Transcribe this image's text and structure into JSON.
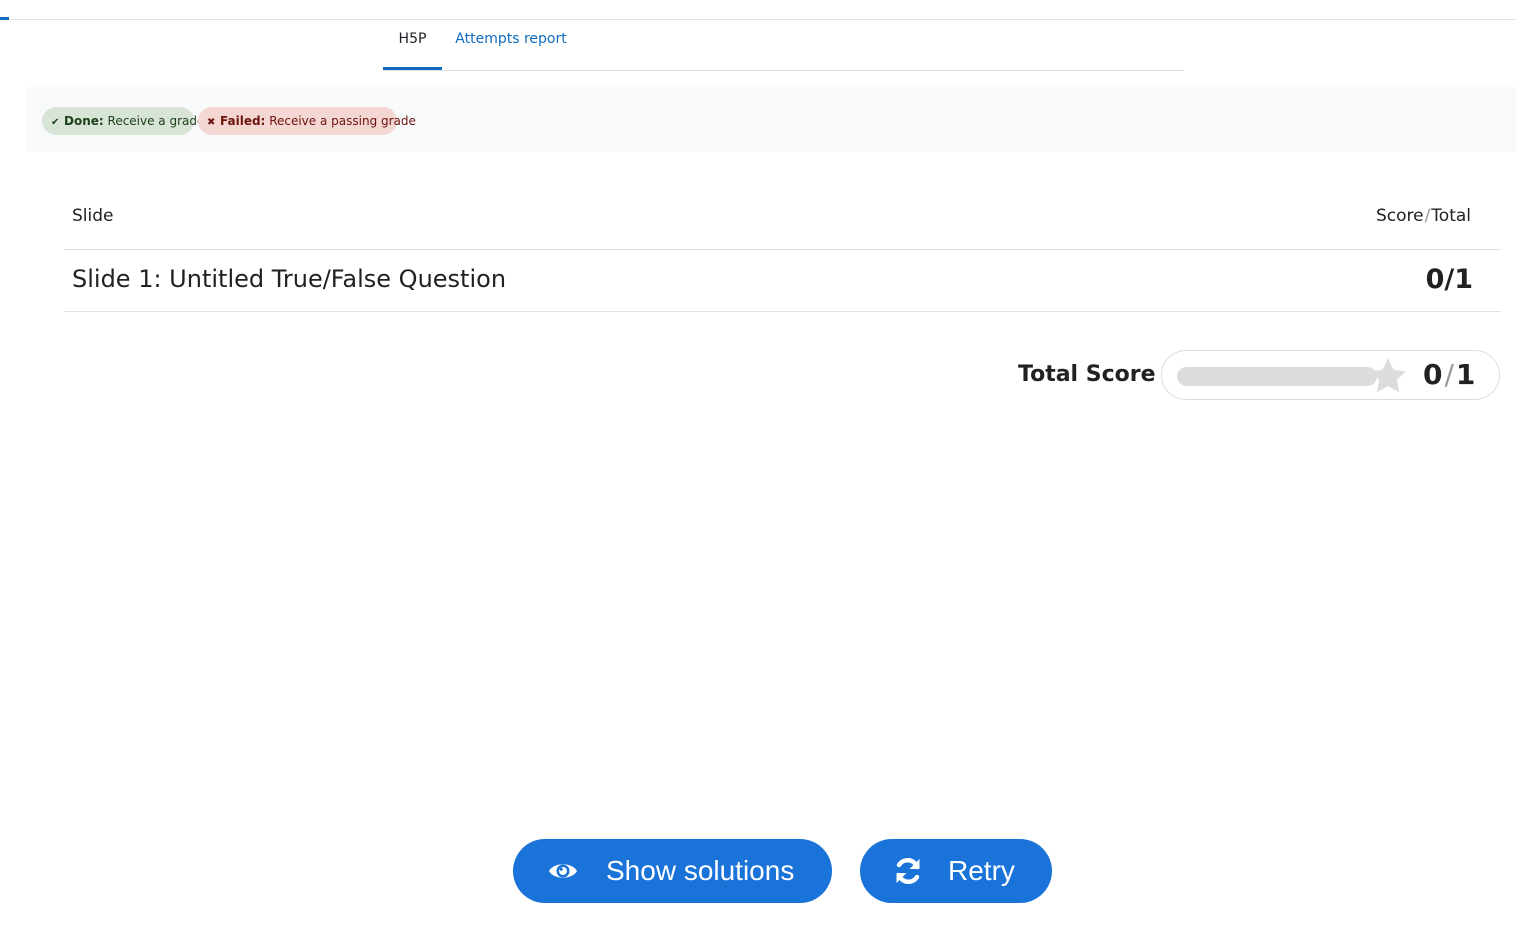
{
  "nav": {
    "tabs": [
      {
        "label": "H5P",
        "active": true
      },
      {
        "label": "Attempts report",
        "active": false
      }
    ]
  },
  "completion": {
    "done": {
      "label": "Done:",
      "text": "Receive a grade",
      "icon": "check-icon",
      "color": "#d7e4d6"
    },
    "failed": {
      "label": "Failed:",
      "text": "Receive a passing grade",
      "icon": "x-icon",
      "color": "#f4d6d2"
    }
  },
  "summary": {
    "header": {
      "slide": "Slide",
      "score": "Score",
      "sep": "/",
      "total": "Total"
    },
    "rows": [
      {
        "title": "Slide 1: Untitled True/False Question",
        "score": "0/1"
      }
    ],
    "total": {
      "label": "Total Score",
      "score": "0",
      "sep": "/",
      "max": "1",
      "fraction": 0
    }
  },
  "buttons": {
    "show_solutions": {
      "label": "Show solutions",
      "icon": "eye-icon"
    },
    "retry": {
      "label": "Retry",
      "icon": "refresh-icon"
    }
  },
  "colors": {
    "accent": "#1a73d9",
    "link": "#0f6cbf"
  }
}
